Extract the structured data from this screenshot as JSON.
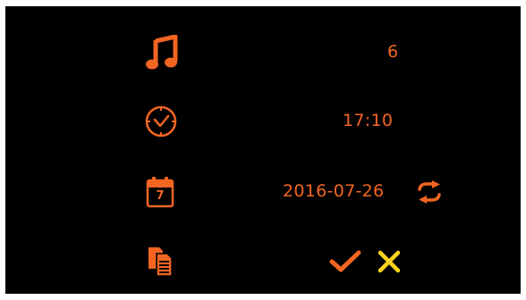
{
  "colors": {
    "background": "#000000",
    "accent": "#f26522",
    "cancel": "#ffd21f"
  },
  "rows": {
    "music": {
      "icon": "music-note-icon",
      "value": "6"
    },
    "time": {
      "icon": "clock-icon",
      "value": "17:10"
    },
    "date": {
      "icon": "calendar-icon",
      "calendar_day": "7",
      "value": "2016-07-26",
      "action_icon": "repeat-arrows-icon"
    },
    "copy": {
      "icon": "copy-documents-icon",
      "confirm_icon": "checkmark-icon",
      "cancel_icon": "x-icon"
    }
  }
}
